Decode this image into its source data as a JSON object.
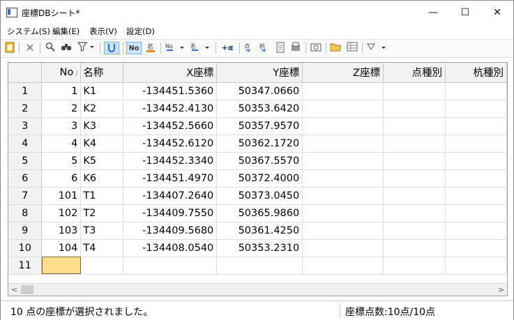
{
  "window": {
    "title": "座標DBシート*",
    "minimize": "—",
    "maximize": "☐",
    "close": "✕"
  },
  "menu": {
    "items": [
      "システム(S)",
      "編集(E)",
      "表示(V)",
      "設定(D)"
    ]
  },
  "toolbar": {
    "no_label": "No",
    "alpha_label": "+α",
    "filter_glyph": "∇"
  },
  "grid": {
    "columns": [
      "No",
      "名称",
      "X座標",
      "Y座標",
      "Z座標",
      "点種別",
      "杭種別"
    ],
    "sort_indicator": "∕",
    "rows": [
      {
        "row": "1",
        "no": "1",
        "name": "K1",
        "x": "-134451.5360",
        "y": "50347.0660",
        "z": "",
        "pt": "",
        "pile": ""
      },
      {
        "row": "2",
        "no": "2",
        "name": "K2",
        "x": "-134452.4130",
        "y": "50353.6420",
        "z": "",
        "pt": "",
        "pile": ""
      },
      {
        "row": "3",
        "no": "3",
        "name": "K3",
        "x": "-134452.5660",
        "y": "50357.9570",
        "z": "",
        "pt": "",
        "pile": ""
      },
      {
        "row": "4",
        "no": "4",
        "name": "K4",
        "x": "-134452.6120",
        "y": "50362.1720",
        "z": "",
        "pt": "",
        "pile": ""
      },
      {
        "row": "5",
        "no": "5",
        "name": "K5",
        "x": "-134452.3340",
        "y": "50367.5570",
        "z": "",
        "pt": "",
        "pile": ""
      },
      {
        "row": "6",
        "no": "6",
        "name": "K6",
        "x": "-134451.4970",
        "y": "50372.4000",
        "z": "",
        "pt": "",
        "pile": ""
      },
      {
        "row": "7",
        "no": "101",
        "name": "T1",
        "x": "-134407.2640",
        "y": "50373.0450",
        "z": "",
        "pt": "",
        "pile": ""
      },
      {
        "row": "8",
        "no": "102",
        "name": "T2",
        "x": "-134409.7550",
        "y": "50365.9860",
        "z": "",
        "pt": "",
        "pile": ""
      },
      {
        "row": "9",
        "no": "103",
        "name": "T3",
        "x": "-134409.5680",
        "y": "50361.4250",
        "z": "",
        "pt": "",
        "pile": ""
      },
      {
        "row": "10",
        "no": "104",
        "name": "T4",
        "x": "-134408.0540",
        "y": "50353.2310",
        "z": "",
        "pt": "",
        "pile": ""
      },
      {
        "row": "11",
        "no": "",
        "name": "",
        "x": "",
        "y": "",
        "z": "",
        "pt": "",
        "pile": ""
      }
    ]
  },
  "scroll": {
    "left": "<",
    "right": ">"
  },
  "status": {
    "message": "10 点の座標が選択されました。",
    "count": "座標点数:10点/10点"
  },
  "colors": {
    "selected_cell": "#ffe08c",
    "header_bg": "#f2f2f2"
  }
}
